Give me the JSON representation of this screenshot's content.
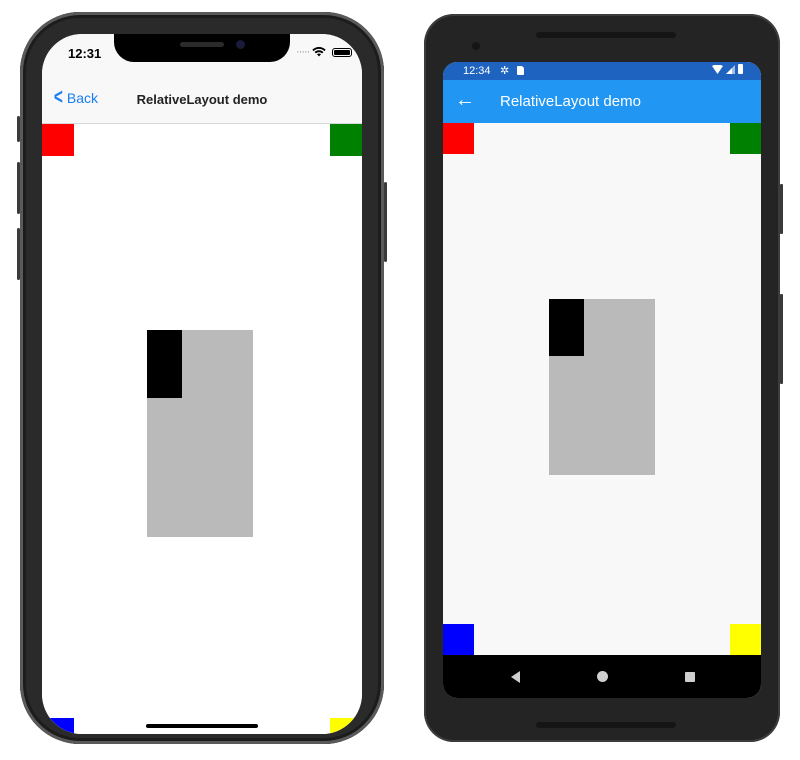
{
  "colors": {
    "red": "#ff0000",
    "green": "#008000",
    "blue": "#0000ff",
    "yellow": "#ffff00",
    "gray": "#bababa",
    "black": "#000000",
    "ios_accent": "#1a7ef2",
    "android_status": "#1e63bf",
    "android_appbar": "#2196f3"
  },
  "ios": {
    "status": {
      "time": "12:31",
      "signal_icon": "signal-dots-icon",
      "wifi_icon": "wifi-icon",
      "battery_icon": "battery-icon"
    },
    "nav": {
      "back_label": "Back",
      "back_icon": "chevron-left-icon",
      "title": "RelativeLayout demo"
    }
  },
  "android": {
    "status": {
      "time": "12:34",
      "icons": [
        "gear-icon",
        "sd-card-icon",
        "wifi-icon",
        "signal-icon",
        "battery-icon"
      ]
    },
    "appbar": {
      "back_icon": "arrow-left-icon",
      "title": "RelativeLayout demo"
    },
    "navbar": {
      "buttons": [
        "back-triangle-icon",
        "home-circle-icon",
        "recents-square-icon"
      ]
    }
  }
}
